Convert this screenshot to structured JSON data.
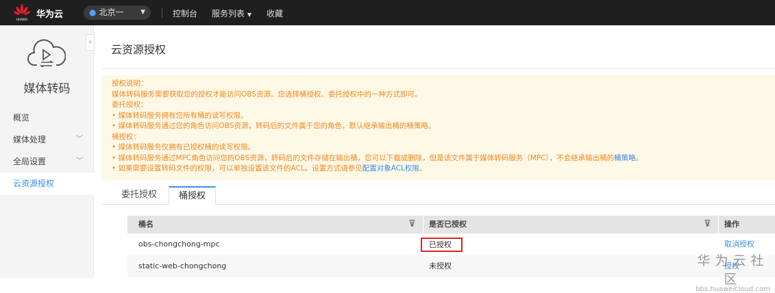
{
  "topbar": {
    "logo_text": "HUAWEI",
    "brand": "华为云",
    "region": "北京一",
    "nav": [
      "控制台",
      "服务列表",
      "收藏"
    ]
  },
  "sidebar": {
    "service_name": "媒体转码",
    "items": [
      {
        "label": "概览"
      },
      {
        "label": "媒体处理"
      },
      {
        "label": "全局设置"
      },
      {
        "label": "云资源授权"
      }
    ]
  },
  "page": {
    "title": "云资源授权"
  },
  "notice": {
    "lines": [
      "授权说明：",
      "媒体转码服务需要获取您的授权才能访问OBS资源。您选择桶授权、委托授权中的一种方式即可。",
      "委托授权：",
      "• 媒体转码服务拥有您所有桶的读写权限。",
      "• 媒体转码服务通过您的角色访问OBS资源，转码后的文件属于您的角色，默认继承输出桶的桶策略。",
      "桶授权：",
      "• 媒体转码服务仅拥有已授权桶的读写权限。",
      "• 媒体转码服务通过MPC角色访问您的OBS资源，转码后的文件存储在输出桶，您可以下载或删除，但是该文件属于媒体转码服务（MPC），不会继承输出桶的",
      "• 如果需要设置转码文件的权限，可以单独设置该文件的ACL。设置方式请参见"
    ],
    "link_policy": "桶策略",
    "link_policy_tail": "。",
    "link_acl": "配置对象ACL权限",
    "link_acl_tail": "。"
  },
  "tabs": [
    {
      "label": "委托授权"
    },
    {
      "label": "桶授权",
      "active": true
    }
  ],
  "table": {
    "headers": [
      "桶名",
      "是否已授权",
      "操作"
    ],
    "rows": [
      {
        "name": "obs-chongchong-mpc",
        "status": "已授权",
        "action": "取消授权"
      },
      {
        "name": "static-web-chongchong",
        "status": "未授权",
        "action": "授权"
      }
    ]
  },
  "watermark": {
    "title": "华为云社区",
    "url": "bbs.huaweicloud.com"
  }
}
